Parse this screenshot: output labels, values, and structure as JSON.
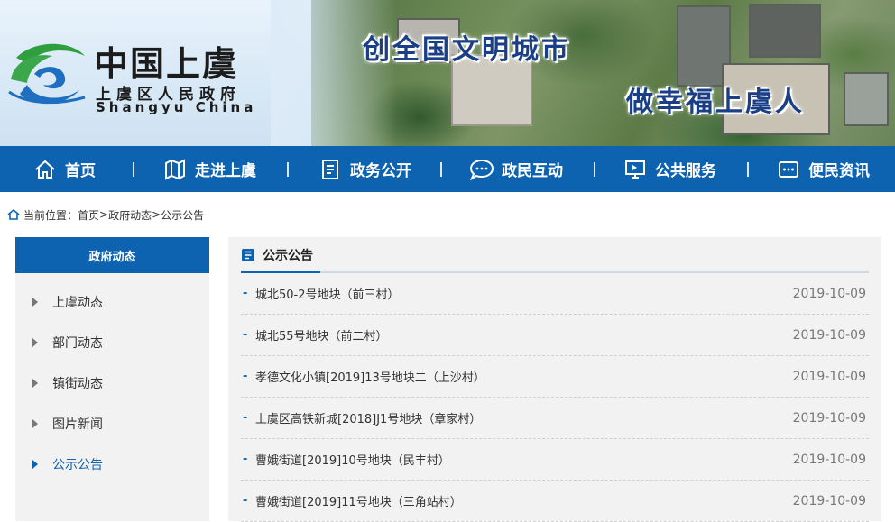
{
  "header": {
    "logo_cn": "中国上虞",
    "logo_sub": "上虞区人民政府",
    "logo_en": "Shangyu China",
    "slogan1": "创全国文明城市",
    "slogan2": "做幸福上虞人"
  },
  "nav": {
    "items": [
      {
        "label": "首页",
        "icon": "home-icon"
      },
      {
        "label": "走进上虞",
        "icon": "map-icon"
      },
      {
        "label": "政务公开",
        "icon": "document-icon"
      },
      {
        "label": "政民互动",
        "icon": "chat-icon"
      },
      {
        "label": "公共服务",
        "icon": "monitor-icon"
      },
      {
        "label": "便民资讯",
        "icon": "info-icon"
      }
    ]
  },
  "breadcrumb": {
    "prefix": "当前位置：",
    "items": [
      "首页",
      "政府动态",
      "公示公告"
    ],
    "separator": ">"
  },
  "sidebar": {
    "title": "政府动态",
    "items": [
      {
        "label": "上虞动态",
        "active": false
      },
      {
        "label": "部门动态",
        "active": false
      },
      {
        "label": "镇街动态",
        "active": false
      },
      {
        "label": "图片新闻",
        "active": false
      },
      {
        "label": "公示公告",
        "active": true
      }
    ]
  },
  "main": {
    "title": "公示公告",
    "bullet": "-",
    "rows": [
      {
        "title": "城北50-2号地块（前三村）",
        "date": "2019-10-09"
      },
      {
        "title": "城北55号地块（前二村）",
        "date": "2019-10-09"
      },
      {
        "title": "孝德文化小镇[2019]13号地块二（上沙村）",
        "date": "2019-10-09"
      },
      {
        "title": "上虞区高铁新城[2018]J1号地块（章家村）",
        "date": "2019-10-09"
      },
      {
        "title": "曹娥街道[2019]10号地块（民丰村）",
        "date": "2019-10-09"
      },
      {
        "title": "曹娥街道[2019]11号地块（三角站村）",
        "date": "2019-10-09"
      }
    ]
  },
  "colors": {
    "primary": "#0d63b0",
    "slogan": "#1a3f86",
    "panel_bg": "#f2f2f2"
  }
}
